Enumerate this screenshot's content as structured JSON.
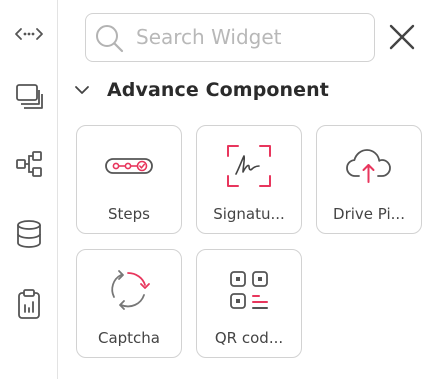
{
  "search": {
    "placeholder": "Search Widget",
    "value": ""
  },
  "section": {
    "title": "Advance Component"
  },
  "widgets": [
    {
      "label": "Steps",
      "icon": "steps-icon"
    },
    {
      "label": "Signatu...",
      "icon": "signature-icon"
    },
    {
      "label": "Drive Pi...",
      "icon": "drive-picker-icon"
    },
    {
      "label": "Captcha",
      "icon": "captcha-icon"
    },
    {
      "label": "QR cod...",
      "icon": "qr-code-icon"
    }
  ],
  "rail": [
    "code-icon",
    "layers-icon",
    "hierarchy-icon",
    "database-icon",
    "clipboard-icon"
  ],
  "colors": {
    "accent": "#e8365d",
    "icon": "#555555",
    "border": "#d2d2d2"
  }
}
